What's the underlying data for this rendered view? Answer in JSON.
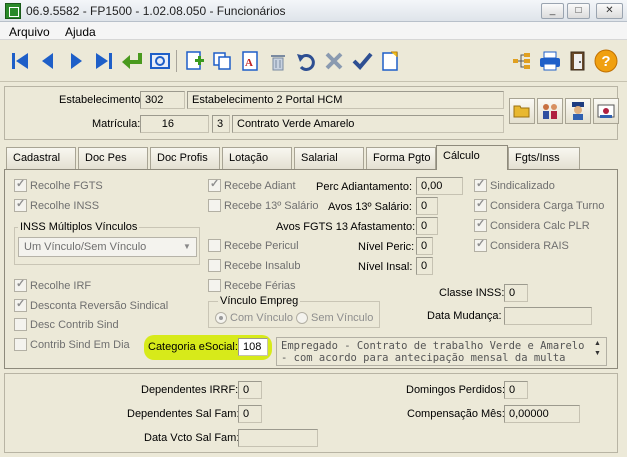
{
  "window": {
    "title": "06.9.5582 - FP1500 - 1.02.08.050 - Funcionários",
    "minimize": "_",
    "maximize": "□",
    "close": "✕"
  },
  "menu": {
    "file": "Arquivo",
    "help": "Ajuda"
  },
  "toolbar": {
    "buttons": [
      "first-icon",
      "previous-icon",
      "next-icon",
      "last-icon",
      "return-icon",
      "preview-icon",
      "new-record-icon",
      "copy-icon",
      "edit-text-icon",
      "delete-icon",
      "undo-icon",
      "cancel-icon",
      "confirm-icon",
      "new-document-icon",
      "tree-icon",
      "print-icon",
      "exit-icon",
      "help-icon"
    ],
    "help_label": "?"
  },
  "header": {
    "estabelecimento_label": "Estabelecimento:",
    "estabelecimento_code": "302",
    "estabelecimento_name": "Estabelecimento 2 Portal HCM",
    "matricula_label": "Matrícula:",
    "matricula_value": "16",
    "contrato_code": "3",
    "contrato_name": "Contrato Verde Amarelo"
  },
  "tabs": [
    "Cadastral",
    "Doc Pes",
    "Doc Profis",
    "Lotação",
    "Salarial",
    "Forma Pgto",
    "Cálculo",
    "Fgts/Inss"
  ],
  "active_tab": "Cálculo",
  "calc": {
    "recolhe_fgts": "Recolhe FGTS",
    "recolhe_inss": "Recolhe INSS",
    "inss_group_title": "INSS Múltiplos Vínculos",
    "inss_select_value": "Um Vínculo/Sem Vínculo",
    "recolhe_irf": "Recolhe IRF",
    "desconta_reversao": "Desconta Reversão Sindical",
    "desc_contrib_sind": "Desc Contrib Sind",
    "contrib_sind_em_dia": "Contrib Sind Em Dia",
    "recebe_adiant": "Recebe Adiant",
    "recebe_13_salario": "Recebe 13º Salário",
    "recebe_pericul": "Recebe Pericul",
    "recebe_insalub": "Recebe Insalub",
    "recebe_ferias": "Recebe Férias",
    "vinculo_group_title": "Vínculo Empreg",
    "com_vinculo": "Com Vínculo",
    "sem_vinculo": "Sem Vínculo",
    "perc_adiantamento_label": "Perc Adiantamento:",
    "perc_adiantamento_value": "0,00",
    "avos_13_label": "Avos 13º Salário:",
    "avos_13_value": "0",
    "avos_fgts_label": "Avos FGTS 13 Afastamento:",
    "avos_fgts_value": "0",
    "nivel_peric_label": "Nível Peric:",
    "nivel_peric_value": "0",
    "nivel_insal_label": "Nível Insal:",
    "nivel_insal_value": "0",
    "sindicalizado": "Sindicalizado",
    "considera_carga_turno": "Considera Carga Turno",
    "considera_calc_plr": "Considera Calc PLR",
    "considera_rais": "Considera RAIS",
    "classe_inss_label": "Classe INSS:",
    "classe_inss_value": "0",
    "data_mudanca_label": "Data Mudança:",
    "data_mudanca_value": "",
    "categoria_label": "Categoria eSocial:",
    "categoria_value": "108",
    "categoria_desc_line1": "Empregado - Contrato de trabalho Verde e Amarelo",
    "categoria_desc_line2": "- com acordo para antecipação mensal da multa"
  },
  "footer": {
    "dependentes_irrf_label": "Dependentes IRRF:",
    "dependentes_irrf_value": "0",
    "dependentes_salfam_label": "Dependentes Sal Fam:",
    "dependentes_salfam_value": "0",
    "data_vcto_label": "Data Vcto Sal Fam:",
    "data_vcto_value": "",
    "domingos_label": "Domingos Perdidos:",
    "domingos_value": "0",
    "compensacao_label": "Compensação Mês:",
    "compensacao_value": "0,00000"
  },
  "colors": {
    "highlight": "#d7ea1a",
    "toolbar_blue": "#1e5fc8"
  }
}
